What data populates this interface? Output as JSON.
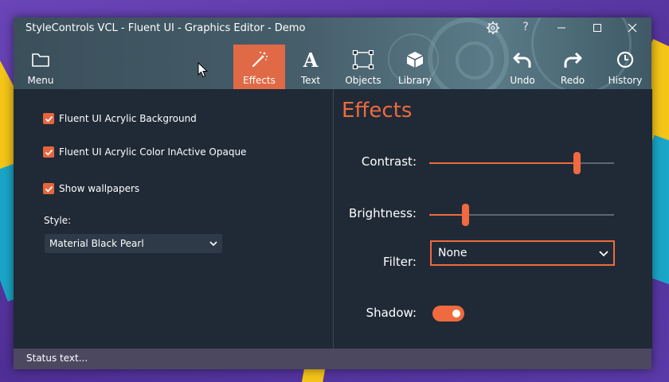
{
  "window": {
    "title": "StyleControls VCL - Fluent UI - Graphics Editor - Demo",
    "title_icons": [
      "gear-icon",
      "help-icon"
    ],
    "help_glyph": "?",
    "controls": [
      "minimize-icon",
      "maximize-icon",
      "close-icon"
    ]
  },
  "toolbar": {
    "menu": {
      "label": "Menu",
      "icon": "folder-icon"
    },
    "effects": {
      "label": "Effects",
      "icon": "magic-wand-icon",
      "active": true
    },
    "text": {
      "label": "Text",
      "icon": "text-a-icon",
      "glyph": "A"
    },
    "objects": {
      "label": "Objects",
      "icon": "objects-icon"
    },
    "library": {
      "label": "Library",
      "icon": "cube-icon"
    },
    "undo": {
      "label": "Undo",
      "icon": "undo-icon"
    },
    "redo": {
      "label": "Redo",
      "icon": "redo-icon"
    },
    "history": {
      "label": "History",
      "icon": "clock-icon"
    }
  },
  "settings": {
    "acrylic_background": {
      "label": "Fluent UI Acrylic Background",
      "checked": true
    },
    "acrylic_color_inactive": {
      "label": "Fluent UI Acrylic Color InActive Opaque",
      "checked": true
    },
    "show_wallpapers": {
      "label": "Show wallpapers",
      "checked": true
    },
    "style_label": "Style:",
    "style_value": "Material Black Pearl"
  },
  "effects": {
    "heading": "Effects",
    "contrast": {
      "label": "Contrast:",
      "value": 0.8
    },
    "brightness": {
      "label": "Brightness:",
      "value": 0.2
    },
    "filter": {
      "label": "Filter:",
      "value": "None"
    },
    "shadow": {
      "label": "Shadow:",
      "on": true
    }
  },
  "status": {
    "text": "Status text..."
  },
  "colors": {
    "accent": "#ef6a3e",
    "panel": "#1f2a36",
    "statusbar": "#4b4860"
  }
}
